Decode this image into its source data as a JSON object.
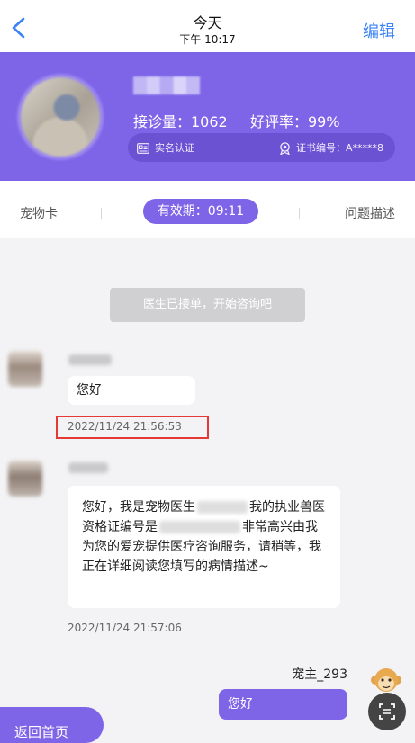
{
  "nav": {
    "title": "今天",
    "subtitle": "下午 10:17",
    "edit_label": "编辑"
  },
  "doctor": {
    "consult_count": "接诊量：1062",
    "rating": "好评率：99%",
    "verified_label": "实名认证",
    "cert_label": "证书编号：A*****8"
  },
  "tabs": {
    "left": "宠物卡",
    "validity": "有效期：09:11",
    "right": "问题描述"
  },
  "chat": {
    "system_message": "医生已接单，开始咨询吧",
    "msg1_text": "您好",
    "msg1_time": "2022/11/24 21:56:53",
    "msg2_text_a": "您好，我是宠物医生",
    "msg2_text_b": "我的执业兽医资格证编号是",
    "msg2_text_c": "非常高兴由我为您的爱宠提供医疗咨询服务，请稍等，我正在详细阅读您填写的病情描述~",
    "msg2_time": "2022/11/24 21:57:06",
    "owner_name": "宠主_293",
    "owner_msg": "您好"
  },
  "footer": {
    "home_label": "返回首页"
  },
  "colors": {
    "accent": "#7e65e8",
    "link": "#3b82f6",
    "highlight": "#e53935"
  }
}
